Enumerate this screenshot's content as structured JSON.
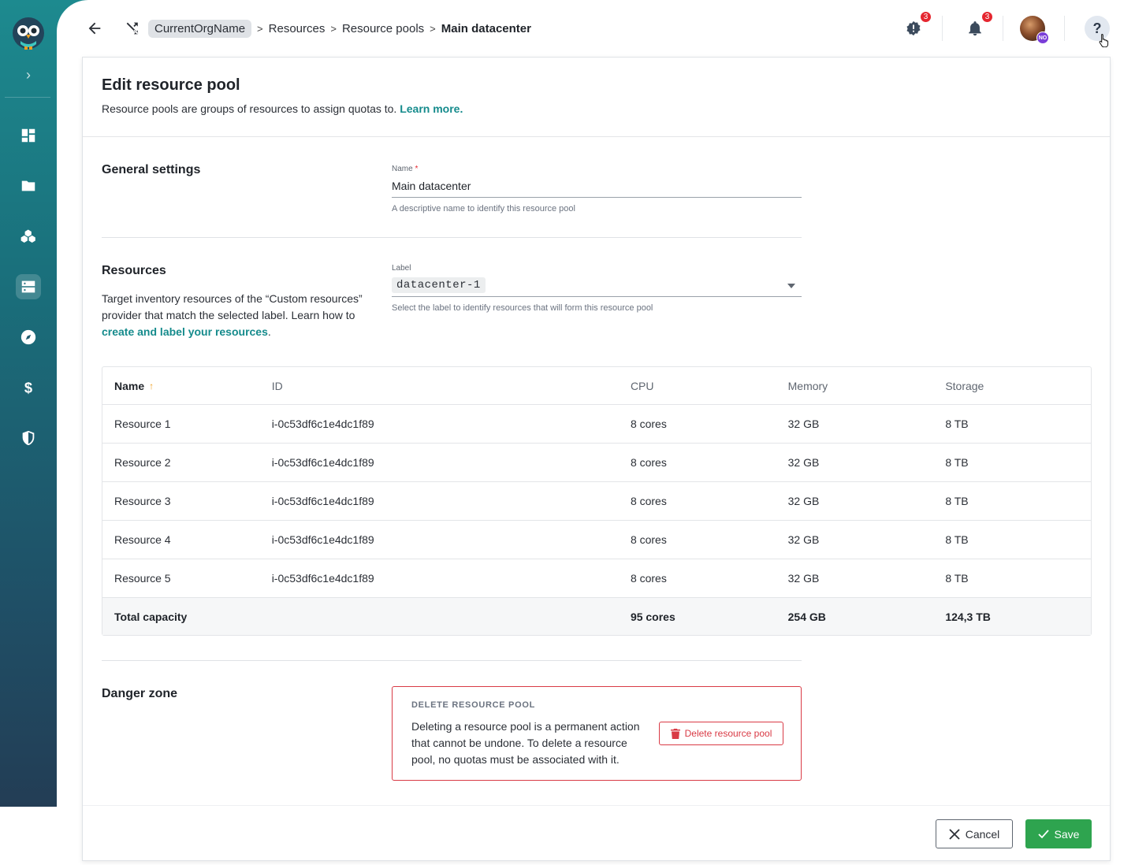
{
  "breadcrumb": {
    "org": "CurrentOrgName",
    "items": [
      "Resources",
      "Resource pools"
    ],
    "current": "Main datacenter"
  },
  "topbar": {
    "alerts_count": "3",
    "notifications_count": "3",
    "avatar_badge": "NO",
    "help_label": "?"
  },
  "header": {
    "title": "Edit resource pool",
    "description": "Resource pools are groups of resources to assign quotas to.",
    "learn_more": "Learn more."
  },
  "general": {
    "section_title": "General settings",
    "name_label": "Name",
    "name_required": "*",
    "name_value": "Main datacenter",
    "name_help": "A descriptive name to identify this resource pool"
  },
  "resources": {
    "section_title": "Resources",
    "description": "Target inventory resources of the “Custom resources” provider that match the selected label. Learn how to",
    "link_text": "create and label your resources",
    "link_suffix": ".",
    "label_label": "Label",
    "label_value": "datacenter-1",
    "label_help": "Select the label to identify resources that will form this resource pool"
  },
  "table": {
    "columns": [
      "Name",
      "ID",
      "CPU",
      "Memory",
      "Storage"
    ],
    "rows": [
      {
        "name": "Resource 1",
        "id": "i-0c53df6c1e4dc1f89",
        "cpu": "8 cores",
        "memory": "32 GB",
        "storage": "8 TB"
      },
      {
        "name": "Resource 2",
        "id": "i-0c53df6c1e4dc1f89",
        "cpu": "8 cores",
        "memory": "32 GB",
        "storage": "8 TB"
      },
      {
        "name": "Resource 3",
        "id": "i-0c53df6c1e4dc1f89",
        "cpu": "8 cores",
        "memory": "32 GB",
        "storage": "8 TB"
      },
      {
        "name": "Resource 4",
        "id": "i-0c53df6c1e4dc1f89",
        "cpu": "8 cores",
        "memory": "32 GB",
        "storage": "8 TB"
      },
      {
        "name": "Resource 5",
        "id": "i-0c53df6c1e4dc1f89",
        "cpu": "8 cores",
        "memory": "32 GB",
        "storage": "8 TB"
      }
    ],
    "total": {
      "label": "Total capacity",
      "cpu": "95 cores",
      "memory": "254 GB",
      "storage": "124,3 TB"
    }
  },
  "danger": {
    "section_title": "Danger zone",
    "box_title": "DELETE RESOURCE POOL",
    "text": "Deleting a resource pool is a permanent action that cannot be undone. To delete a resource pool, no quotas must be associated with it.",
    "delete_label": "Delete resource pool"
  },
  "footer": {
    "cancel_label": "Cancel",
    "save_label": "Save"
  },
  "colors": {
    "accent": "#158b8c",
    "danger": "#d93a45",
    "save": "#2ea44f",
    "badge": "#e5262f"
  },
  "icons": {
    "sidebar": [
      "dashboard-icon",
      "folder-icon",
      "resources-icon",
      "server-icon",
      "compass-icon",
      "dollar-icon",
      "shield-icon"
    ]
  }
}
